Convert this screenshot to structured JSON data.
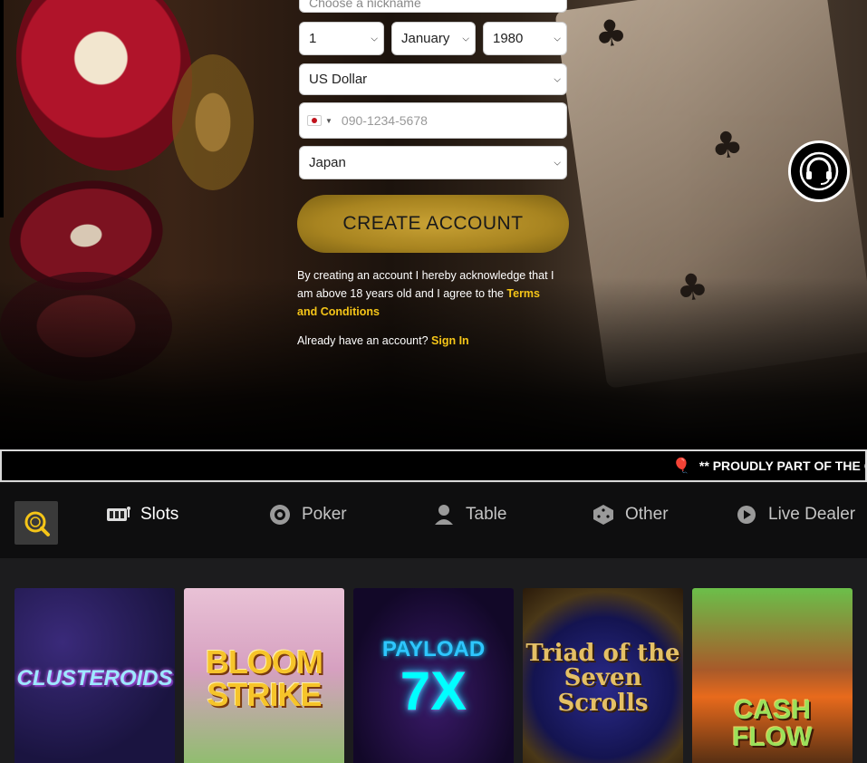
{
  "signup_form": {
    "nickname_placeholder": "Choose a nickname",
    "dob_day": "1",
    "dob_month": "January",
    "dob_year": "1980",
    "currency": "US Dollar",
    "phone_country_flag": "jp-flag-icon",
    "phone_placeholder": "090-1234-5678",
    "country": "Japan",
    "create_button": "CREATE ACCOUNT",
    "terms_text": "By creating an account I hereby acknowledge that I am above 18 years old and I agree to the ",
    "terms_link": "Terms and Conditions",
    "signin_prompt": "Already have an account? ",
    "signin_link": "Sign In"
  },
  "support": {
    "icon": "headset-support-icon"
  },
  "ticker": {
    "icon": "balloons-icon",
    "text": "** PROUDLY PART OF THE GE"
  },
  "categories": [
    {
      "label": "Slots",
      "icon": "slot-machine-icon",
      "active": true
    },
    {
      "label": "Poker",
      "icon": "poker-chip-icon",
      "active": false
    },
    {
      "label": "Table",
      "icon": "dealer-icon",
      "active": false
    },
    {
      "label": "Other",
      "icon": "dice-icon",
      "active": false
    },
    {
      "label": "Live Dealer",
      "icon": "play-icon",
      "active": false
    }
  ],
  "games": [
    {
      "title": "CLUSTEROIDS"
    },
    {
      "title": "BLOOM STRIKE"
    },
    {
      "title_line1": "PAYLOAD",
      "title_line2": "7X"
    },
    {
      "title": "Triad of the Seven Scrolls"
    },
    {
      "title": "CASH FLOW"
    }
  ],
  "colors": {
    "accent_gold": "#f5c518",
    "button_gold": "#c8a134",
    "nav_bg": "#0e0e0f"
  }
}
